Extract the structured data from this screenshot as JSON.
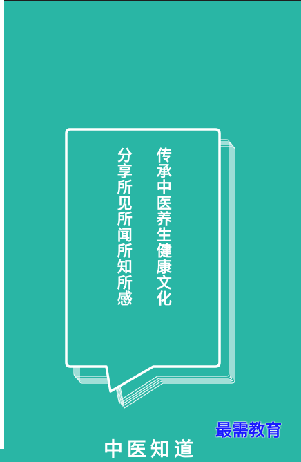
{
  "splash": {
    "line_right": "传承中医养生健康文化",
    "line_left": "分享所见所闻所知所感",
    "app_title": "中医知道",
    "watermark": "最需教育"
  },
  "colors": {
    "background": "#29b6a5",
    "foreground": "#ffffff",
    "watermark": "#1a1aff"
  }
}
